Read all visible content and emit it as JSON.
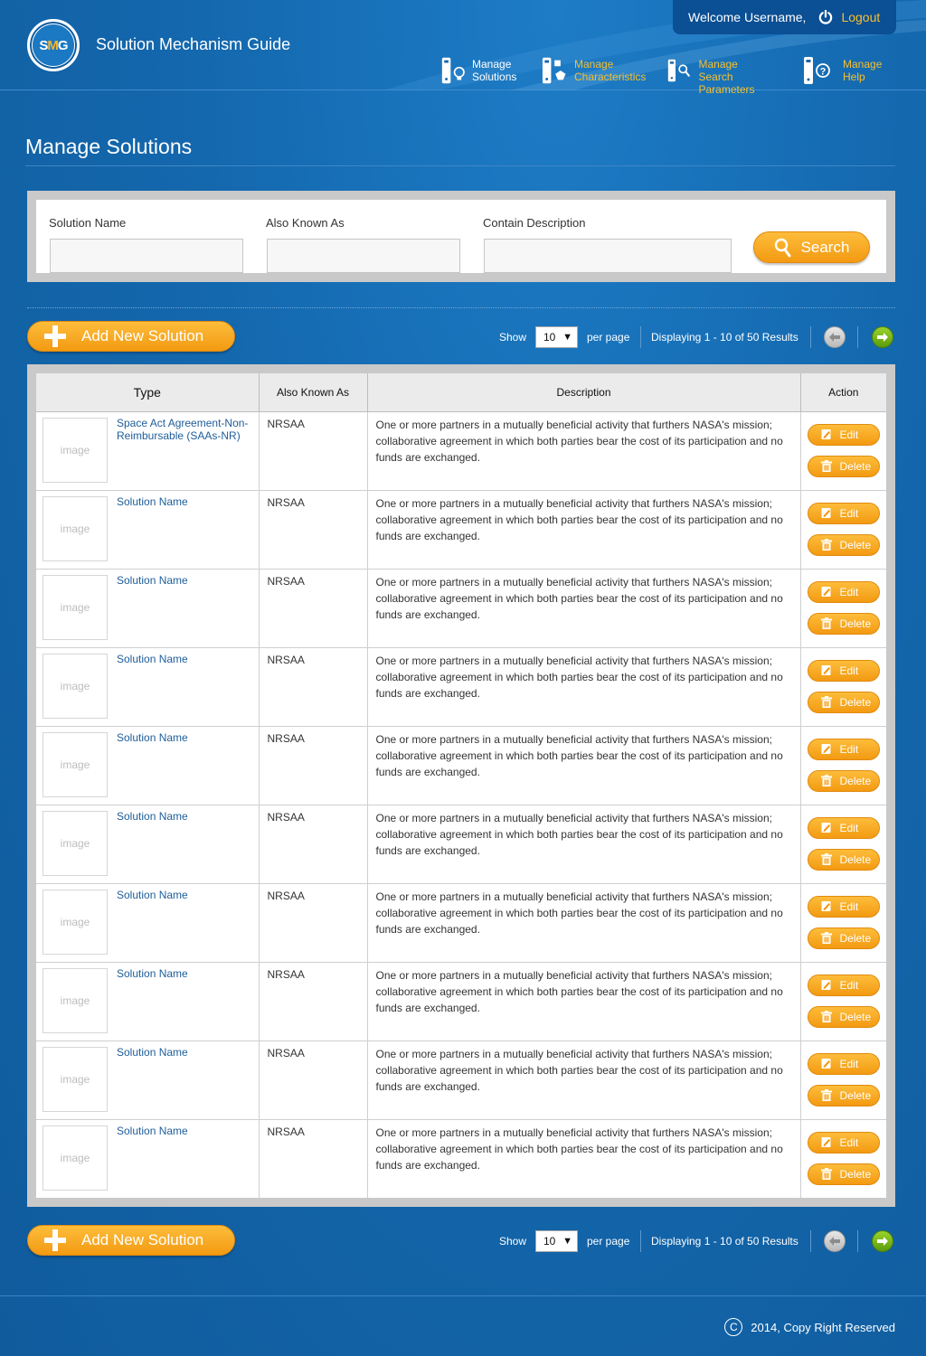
{
  "header": {
    "logo_text_s": "S",
    "logo_text_m": "M",
    "logo_text_g": "G",
    "app_title": "Solution Mechanism Guide",
    "welcome": "Welcome Username,",
    "logout_label": "Logout"
  },
  "nav": [
    {
      "label_line1": "Manage",
      "label_line2": "Solutions",
      "icon": "lightbulb-icon",
      "active": true
    },
    {
      "label_line1": "Manage",
      "label_line2": "Characteristics",
      "icon": "shapes-icon",
      "active": false
    },
    {
      "label_line1": "Manage Search",
      "label_line2": "Parameters",
      "icon": "magnifier-icon",
      "active": false
    },
    {
      "label_line1": "Manage",
      "label_line2": "Help",
      "icon": "help-icon",
      "active": false
    }
  ],
  "page_title": "Manage Solutions",
  "search": {
    "solution_name_label": "Solution Name",
    "solution_name_value": "",
    "aka_label": "Also Known As",
    "aka_value": "",
    "description_label": "Contain Description",
    "description_value": "",
    "search_label": "Search"
  },
  "toolbar": {
    "add_label": "Add New Solution",
    "show_label": "Show",
    "per_page_value": "10",
    "per_page_label": "per page",
    "displaying": "Displaying 1 - 10 of 50 Results"
  },
  "table": {
    "headers": {
      "type": "Type",
      "aka": "Also Known As",
      "description": "Description",
      "action": "Action"
    },
    "image_placeholder": "image",
    "edit_label": "Edit",
    "delete_label": "Delete",
    "rows": [
      {
        "name": "Space Act Agreement-Non-Reimbursable (SAAs-NR)",
        "aka": "NRSAA",
        "description": "One or more partners in a mutually beneficial activity that furthers NASA's mission; collaborative agreement in which both parties bear the cost of its participation and no funds are exchanged."
      },
      {
        "name": "Solution Name",
        "aka": "NRSAA",
        "description": "One or more partners in a mutually beneficial activity that furthers NASA's mission; collaborative agreement in which both parties bear the cost of its participation and no funds are exchanged."
      },
      {
        "name": "Solution Name",
        "aka": "NRSAA",
        "description": "One or more partners in a mutually beneficial activity that furthers NASA's mission; collaborative agreement in which both parties bear the cost of its participation and no funds are exchanged."
      },
      {
        "name": "Solution Name",
        "aka": "NRSAA",
        "description": "One or more partners in a mutually beneficial activity that furthers NASA's mission; collaborative agreement in which both parties bear the cost of its participation and no funds are exchanged."
      },
      {
        "name": "Solution Name",
        "aka": "NRSAA",
        "description": "One or more partners in a mutually beneficial activity that furthers NASA's mission; collaborative agreement in which both parties bear the cost of its participation and no funds are exchanged."
      },
      {
        "name": "Solution Name",
        "aka": "NRSAA",
        "description": "One or more partners in a mutually beneficial activity that furthers NASA's mission; collaborative agreement in which both parties bear the cost of its participation and no funds are exchanged."
      },
      {
        "name": "Solution Name",
        "aka": "NRSAA",
        "description": "One or more partners in a mutually beneficial activity that furthers NASA's mission; collaborative agreement in which both parties bear the cost of its participation and no funds are exchanged."
      },
      {
        "name": "Solution Name",
        "aka": "NRSAA",
        "description": "One or more partners in a mutually beneficial activity that furthers NASA's mission; collaborative agreement in which both parties bear the cost of its participation and no funds are exchanged."
      },
      {
        "name": "Solution Name",
        "aka": "NRSAA",
        "description": "One or more partners in a mutually beneficial activity that furthers NASA's mission; collaborative agreement in which both parties bear the cost of its participation and no funds are exchanged."
      },
      {
        "name": "Solution Name",
        "aka": "NRSAA",
        "description": "One or more partners in a mutually beneficial activity that furthers NASA's mission; collaborative agreement in which both parties bear the cost of its participation and no funds are exchanged."
      }
    ]
  },
  "footer": {
    "copyright_symbol": "C",
    "copyright": "2014, Copy Right Reserved"
  },
  "colors": {
    "background": "#1467ad",
    "accent_orange": "#f39a12",
    "nav_yellow": "#f7c02f",
    "link_blue": "#1f5d99",
    "next_green": "#5b9b0c"
  }
}
